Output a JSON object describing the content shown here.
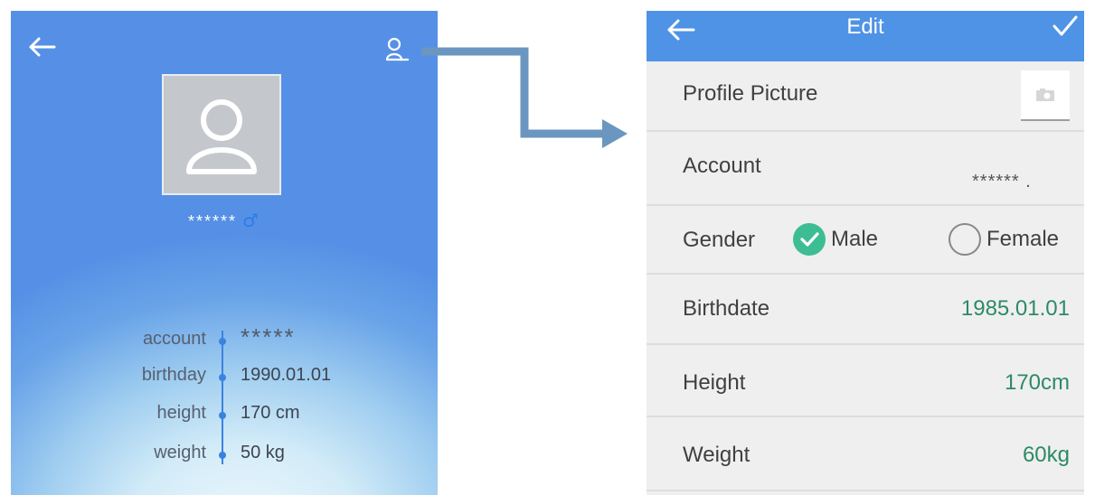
{
  "profile_view": {
    "username": "******",
    "gender_symbol": "♂",
    "fields": [
      {
        "label": "account",
        "value": "*****"
      },
      {
        "label": "birthday",
        "value": "1990.01.01"
      },
      {
        "label": "height",
        "value": "170 cm"
      },
      {
        "label": "weight",
        "value": "50 kg"
      }
    ]
  },
  "edit_view": {
    "title": "Edit",
    "profile_picture_label": "Profile Picture",
    "account_label": "Account",
    "account_value": "****** .",
    "gender_label": "Gender",
    "gender_options": [
      {
        "label": "Male",
        "selected": true
      },
      {
        "label": "Female",
        "selected": false
      }
    ],
    "birthdate_label": "Birthdate",
    "birthdate_value": "1985.01.01",
    "height_label": "Height",
    "height_value": "170cm",
    "weight_label": "Weight",
    "weight_value": "60kg"
  },
  "colors": {
    "header_blue": "#4f93e6",
    "value_green": "#2d8a66",
    "radio_green": "#3dbd93",
    "connector": "#6b96c0"
  },
  "icons": [
    "back-arrow-icon",
    "edit-profile-icon",
    "avatar-placeholder-icon",
    "male-symbol-icon",
    "checkmark-icon",
    "camera-icon",
    "connector-arrow-icon"
  ]
}
